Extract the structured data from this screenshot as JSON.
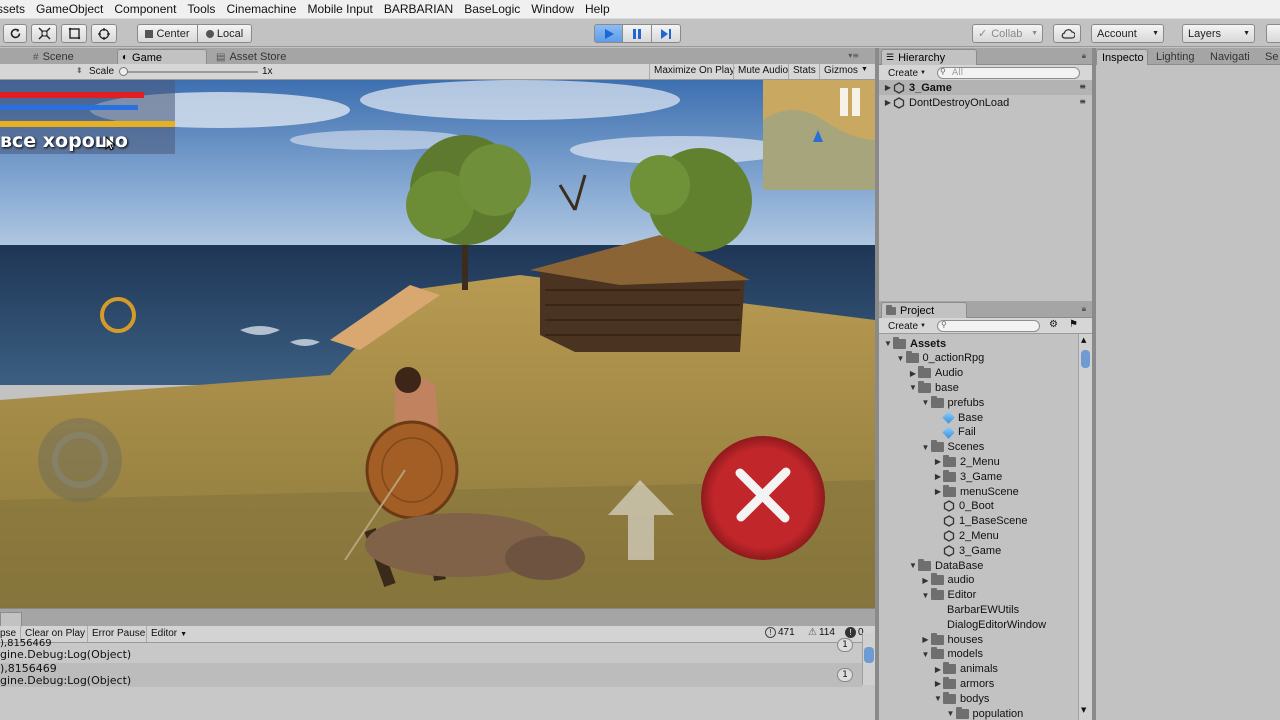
{
  "menu": [
    "ssets",
    "GameObject",
    "Component",
    "Tools",
    "Cinemachine",
    "Mobile Input",
    "BARBARIAN",
    "BaseLogic",
    "Window",
    "Help"
  ],
  "toolbar": {
    "center_label": "Center",
    "local_label": "Local",
    "collab_label": "Collab",
    "account_label": "Account",
    "layers_label": "Layers"
  },
  "tabs": {
    "scene": "Scene",
    "game": "Game",
    "asset_store": "Asset Store",
    "hierarchy": "Hierarchy",
    "inspector": "Inspecto",
    "lighting": "Lighting",
    "navigation": "Navigati",
    "services": "Se",
    "project": "Project"
  },
  "game_toolbar": {
    "scale_label": "Scale",
    "scale_value": "1x",
    "maximize_on_play": "Maximize On Play",
    "mute_audio": "Mute Audio",
    "stats": "Stats",
    "gizmos": "Gizmos"
  },
  "hud": {
    "status_text": "все хорошо",
    "health_fraction": 0.82,
    "mana_fraction": 0.79,
    "stamina_fraction": 1.0
  },
  "console": {
    "collapse_label": "pse",
    "clear_on_play": "Clear on Play",
    "error_pause": "Error Pause",
    "editor_label": "Editor",
    "log_count": "471",
    "warning_count": "114",
    "error_count": "0",
    "entries": [
      {
        "line1": "),8156469",
        "line2": "gine.Debug:Log(Object)",
        "count": "1"
      },
      {
        "line1": "),8156469",
        "line2": "gine.Debug:Log(Object)",
        "count": "1"
      }
    ]
  },
  "hierarchy": {
    "create_label": "Create",
    "search_placeholder": "All",
    "items": [
      {
        "label": "3_Game",
        "bold": true
      },
      {
        "label": "DontDestroyOnLoad",
        "bold": false
      }
    ]
  },
  "project": {
    "create_label": "Create",
    "tree": [
      {
        "label": "Assets",
        "depth": 0,
        "type": "folder",
        "open": true,
        "bold": true
      },
      {
        "label": "0_actionRpg",
        "depth": 1,
        "type": "folder",
        "open": true
      },
      {
        "label": "Audio",
        "depth": 2,
        "type": "folder",
        "open": false
      },
      {
        "label": "base",
        "depth": 2,
        "type": "folder",
        "open": true
      },
      {
        "label": "prefubs",
        "depth": 3,
        "type": "folder",
        "open": true
      },
      {
        "label": "Base",
        "depth": 4,
        "type": "prefab",
        "open": false
      },
      {
        "label": "Fail",
        "depth": 4,
        "type": "prefab",
        "open": false
      },
      {
        "label": "Scenes",
        "depth": 3,
        "type": "folder",
        "open": true
      },
      {
        "label": "2_Menu",
        "depth": 4,
        "type": "folder",
        "open": false
      },
      {
        "label": "3_Game",
        "depth": 4,
        "type": "folder",
        "open": false
      },
      {
        "label": "menuScene",
        "depth": 4,
        "type": "folder",
        "open": false
      },
      {
        "label": "0_Boot",
        "depth": 4,
        "type": "scene"
      },
      {
        "label": "1_BaseScene",
        "depth": 4,
        "type": "scene"
      },
      {
        "label": "2_Menu",
        "depth": 4,
        "type": "scene"
      },
      {
        "label": "3_Game",
        "depth": 4,
        "type": "scene"
      },
      {
        "label": "DataBase",
        "depth": 2,
        "type": "folder",
        "open": true
      },
      {
        "label": "audio",
        "depth": 3,
        "type": "folder",
        "open": false
      },
      {
        "label": "Editor",
        "depth": 3,
        "type": "folder",
        "open": true
      },
      {
        "label": "BarbarEWUtils",
        "depth": 4,
        "type": "script"
      },
      {
        "label": "DialogEditorWindow",
        "depth": 4,
        "type": "script"
      },
      {
        "label": "houses",
        "depth": 3,
        "type": "folder",
        "open": false
      },
      {
        "label": "models",
        "depth": 3,
        "type": "folder",
        "open": true
      },
      {
        "label": "animals",
        "depth": 4,
        "type": "folder",
        "open": false
      },
      {
        "label": "armors",
        "depth": 4,
        "type": "folder",
        "open": false
      },
      {
        "label": "bodys",
        "depth": 4,
        "type": "folder",
        "open": true
      },
      {
        "label": "population",
        "depth": 5,
        "type": "folder",
        "open": true
      }
    ]
  },
  "colors": {
    "play_active": "#4a8fe0",
    "health": "#e02020",
    "mana": "#2a70e0",
    "stamina": "#e8b020",
    "attack_button": "#c0262a"
  }
}
